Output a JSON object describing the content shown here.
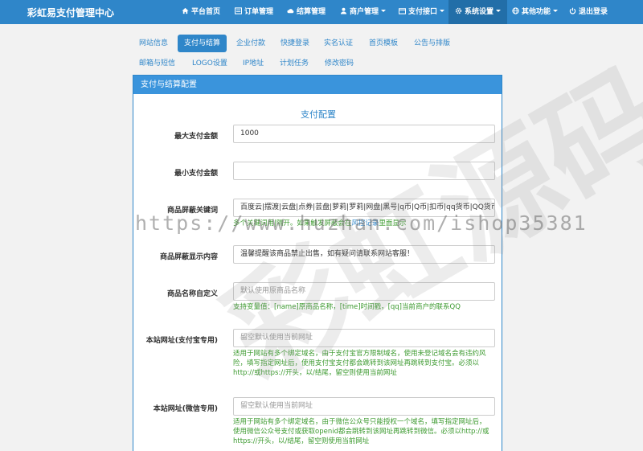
{
  "navbar": {
    "brand": "彩虹易支付管理中心",
    "items": [
      {
        "label": "平台首页",
        "icon": "home-icon"
      },
      {
        "label": "订单管理",
        "icon": "list-icon"
      },
      {
        "label": "结算管理",
        "icon": "cloud-icon"
      },
      {
        "label": "商户管理",
        "icon": "user-icon"
      },
      {
        "label": "支付接口",
        "icon": "folder-icon"
      },
      {
        "label": "系统设置",
        "icon": "gear-icon"
      },
      {
        "label": "其他功能",
        "icon": "globe-icon"
      },
      {
        "label": "退出登录",
        "icon": "power-icon"
      }
    ]
  },
  "tabs": [
    "网站信息",
    "支付与结算",
    "企业付款",
    "快捷登录",
    "实名认证",
    "首页模板",
    "公告与排版",
    "邮箱与短信",
    "LOGO设置",
    "IP地址",
    "计划任务",
    "修改密码"
  ],
  "panel": {
    "heading": "支付与结算配置",
    "section_title": "支付配置",
    "fields": {
      "max_amount": {
        "label": "最大支付金额",
        "value": "1000"
      },
      "min_amount": {
        "label": "最小支付金额",
        "value": ""
      },
      "blocked_keywords": {
        "label": "商品屏蔽关键词",
        "value": "百度云|摆渡|云盘|点券|芸盘|萝莉|罗莉|网盘|黑号|q币|Q币|扣币|qq货币|QQ货币|Q",
        "help": "多个关键词用|隔开。如果触发屏蔽会在",
        "help_link": "风控记录",
        "help_tail": "里面显示"
      },
      "blocked_display": {
        "label": "商品屏蔽显示内容",
        "value": "温馨提醒该商品禁止出售，如有疑问请联系网站客服！"
      },
      "custom_name": {
        "label": "商品名称自定义",
        "placeholder": "默认使用原商品名称",
        "help": "支持变量值：[name]原商品名称，[time]时间戳，[qq]当前商户的联系QQ"
      },
      "site_url_alipay": {
        "label": "本站网址(支付宝专用)",
        "placeholder": "留空默认使用当前网址",
        "help": "适用于网站有多个绑定域名，由于支付宝官方限制域名，使用未登记域名会有违约风险，填写指定网址后，使用支付宝支付都会跳转到该网址再跳转到支付宝。必须以http://或https://开头，以/结尾，留空则使用当前网址"
      },
      "site_url_wechat": {
        "label": "本站网址(微信专用)",
        "placeholder": "留空默认使用当前网址",
        "help": "适用于网站有多个绑定域名，由于微信公众号只能授权一个域名，填写指定网址后，使用微信公众号支付或获取openid都会跳转到该网址再跳转到微信。必须以http://或https://开头，以/结尾，留空则使用当前网址"
      }
    }
  },
  "watermark": {
    "url_text": "https://www.huzhan.com/ishop35381",
    "big_text": "彩虹源码"
  },
  "colors": {
    "primary": "#2f86c9",
    "help_green": "#3c9a2f"
  }
}
